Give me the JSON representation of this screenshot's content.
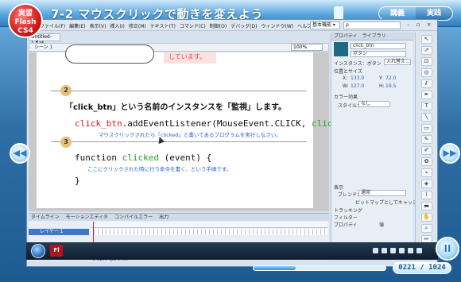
{
  "player": {
    "badge_line1": "実習",
    "badge_line2": "Flash",
    "badge_line3": "CS4",
    "chapter_title": "7-2 マウスクリックで動きを変えよう",
    "mode_explain": "講義",
    "mode_practice": "実践",
    "nav_prev_icon": "◀◀",
    "nav_next_icon": "▶▶",
    "pause_icon": "II",
    "counter": "0221 / 1024",
    "seek_progress": 0.32
  },
  "app": {
    "logo": "Fl",
    "menu": [
      "ファイル(F)",
      "編集(E)",
      "表示(V)",
      "挿入(I)",
      "修正(M)",
      "テキスト(T)",
      "コマンド(C)",
      "制御(O)",
      "デバッグ(D)",
      "ウィンドウ(W)",
      "ヘルプ(H)"
    ],
    "workspace": "基本機能 ▾",
    "search_placeholder": "ρ",
    "window_controls": "– ▫ ×",
    "doc_tab": "Untitled-1.fla*",
    "scene": "シーン 1",
    "zoom": "100%"
  },
  "stage": {
    "red_note": "しています。",
    "step2_num": "2",
    "step2_text": "「click_btn」という名前のインスタンスを「監視」します。",
    "code1_a": "click_btn",
    "code1_b": ".addEventListener(MouseEvent.CLICK, ",
    "code1_c": "clicked",
    "code1_d": ");",
    "note1": "マウスクリックされたら「clicked」と書いてあるプログラムを実行しなさい。",
    "step3_num": "3",
    "code2_a": "function ",
    "code2_b": "clicked",
    "code2_c": " (event) {",
    "note2": "ここにクリックされた時に行う命令を書く、という手順です。",
    "code3": "}"
  },
  "properties": {
    "tabs": [
      "プロパティ",
      "ライブラリ"
    ],
    "instance_name": "click_btn",
    "type": "ボタン",
    "instance_of_label": "インスタンス：ボタン",
    "swap_button": "入れ替え...",
    "position_size": "位置とサイズ",
    "x_label": "X:",
    "x_value": "133.0",
    "y_label": "Y:",
    "y_value": "72.0",
    "w_label": "W:",
    "w_value": "127.0",
    "h_label": "H:",
    "h_value": "19.5",
    "color_effect": "カラー効果",
    "style_label": "スタイル：",
    "style_value": "なし",
    "display": "表示",
    "blend_label": "ブレンド：",
    "blend_value": "通常",
    "cache_label": "ビットマップとしてキャッシュ",
    "tracking": "トラッキング",
    "filter": "フィルター",
    "property_col": "プロパティ",
    "value_col": "値"
  },
  "timeline": {
    "tabs": [
      "タイムライン",
      "モーションエディタ",
      "コンパイルエラー",
      "出力"
    ],
    "layer_name": "レイヤー 1",
    "footer": "1   12.0 fps   0.0s"
  },
  "taskbar": {
    "app_logo": "Fl"
  }
}
